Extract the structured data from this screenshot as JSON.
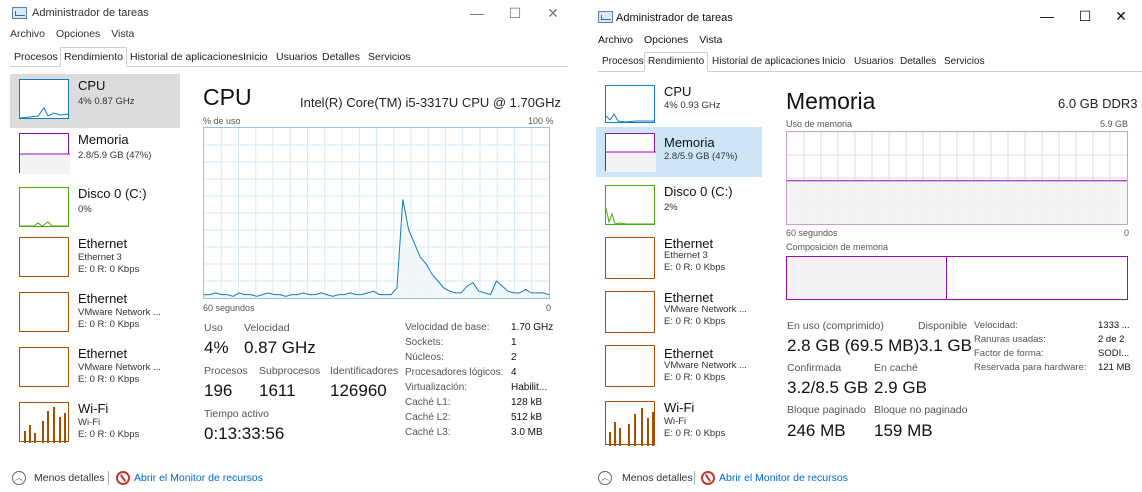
{
  "colors": {
    "cpu": "#117dbb",
    "cpu_fill": "#f1f6fa",
    "memory": "#8b12ae",
    "memory_fill": "#f4f2f4",
    "disk": "#4da60c",
    "ethernet": "#a74f01",
    "wifi": "#a74f01",
    "link": "#0066cc"
  },
  "left": {
    "title": "Administrador de tareas",
    "menu": [
      "Archivo",
      "Opciones",
      "Vista"
    ],
    "tabs": [
      "Procesos",
      "Rendimiento",
      "Historial de aplicaciones",
      "Inicio",
      "Usuarios",
      "Detalles",
      "Servicios"
    ],
    "sidebar": [
      {
        "name": "CPU",
        "line1": "4% 0.87 GHz",
        "line2": ""
      },
      {
        "name": "Memoria",
        "line1": "2.8/5.9 GB (47%)",
        "line2": ""
      },
      {
        "name": "Disco 0 (C:)",
        "line1": "0%",
        "line2": ""
      },
      {
        "name": "Ethernet",
        "line1": "Ethernet 3",
        "line2": "E: 0 R: 0 Kbps"
      },
      {
        "name": "Ethernet",
        "line1": "VMware Network ...",
        "line2": "E: 0 R: 0 Kbps"
      },
      {
        "name": "Ethernet",
        "line1": "VMware Network ...",
        "line2": "E: 0 R: 0 Kbps"
      },
      {
        "name": "Wi-Fi",
        "line1": "Wi-Fi",
        "line2": "E: 0 R: 0 Kbps"
      }
    ],
    "panel": {
      "title": "CPU",
      "spec": "Intel(R) Core(TM) i5-3317U CPU @ 1.70GHz",
      "graph_label": "% de uso",
      "graph_max": "100 %",
      "time_label": "60 segundos",
      "time_end": "0",
      "cpu_history": [
        2,
        2,
        3,
        2,
        2,
        1,
        3,
        2,
        2,
        1,
        2,
        3,
        2,
        2,
        1,
        2,
        2,
        3,
        2,
        2,
        3,
        2,
        1,
        2,
        2,
        3,
        2,
        2,
        3,
        4,
        2,
        2,
        2,
        6,
        58,
        40,
        32,
        24,
        20,
        14,
        10,
        6,
        4,
        3,
        3,
        7,
        9,
        4,
        3,
        2,
        10,
        7,
        4,
        3,
        3,
        5,
        3,
        3,
        3,
        2
      ],
      "stats": {
        "uso_label": "Uso",
        "uso_value": "4%",
        "velocidad_label": "Velocidad",
        "velocidad_value": "0.87 GHz",
        "procesos_label": "Procesos",
        "procesos_value": "196",
        "subprocesos_label": "Subprocesos",
        "subprocesos_value": "1611",
        "identificadores_label": "Identificadores",
        "identificadores_value": "126960",
        "tiempo_label": "Tiempo activo",
        "tiempo_value": "0:13:33:56"
      },
      "specs": [
        {
          "label": "Velocidad de base:",
          "value": "1.70 GHz"
        },
        {
          "label": "Sockets:",
          "value": "1"
        },
        {
          "label": "Núcleos:",
          "value": "2"
        },
        {
          "label": "Procesadores lógicos:",
          "value": "4"
        },
        {
          "label": "Virtualización:",
          "value": "Habilit..."
        },
        {
          "label": "Caché L1:",
          "value": "128 kB"
        },
        {
          "label": "Caché L2:",
          "value": "512 kB"
        },
        {
          "label": "Caché L3:",
          "value": "3.0 MB"
        }
      ]
    },
    "footer": {
      "less": "Menos detalles",
      "monitor": "Abrir el Monitor de recursos"
    }
  },
  "right": {
    "title": "Administrador de tareas",
    "menu": [
      "Archivo",
      "Opciones",
      "Vista"
    ],
    "tabs": [
      "Procesos",
      "Rendimiento",
      "Historial de aplicaciones",
      "Inicio",
      "Usuarios",
      "Detalles",
      "Servicios"
    ],
    "sidebar": [
      {
        "name": "CPU",
        "line1": "4% 0.93 GHz",
        "line2": ""
      },
      {
        "name": "Memoria",
        "line1": "2.8/5.9 GB (47%)",
        "line2": ""
      },
      {
        "name": "Disco 0 (C:)",
        "line1": "2%",
        "line2": ""
      },
      {
        "name": "Ethernet",
        "line1": "Ethernet 3",
        "line2": "E: 0 R: 0 Kbps"
      },
      {
        "name": "Ethernet",
        "line1": "VMware Network ...",
        "line2": "E: 0 R: 0 Kbps"
      },
      {
        "name": "Ethernet",
        "line1": "VMware Network ...",
        "line2": "E: 0 R: 0 Kbps"
      },
      {
        "name": "Wi-Fi",
        "line1": "Wi-Fi",
        "line2": "E: 0 R: 0 Kbps"
      }
    ],
    "panel": {
      "title": "Memoria",
      "spec": "6.0 GB DDR3",
      "graph_label": "Uso de memoria",
      "graph_max": "5.9 GB",
      "time_label": "60 segundos",
      "time_end": "0",
      "composition_label": "Composición de memoria",
      "memory_used_fraction": 0.47,
      "stats": {
        "enuso_label": "En uso (comprimido)",
        "enuso_value": "2.8 GB (69.5 MB)",
        "disponible_label": "Disponible",
        "disponible_value": "3.1 GB",
        "confirmada_label": "Confirmada",
        "confirmada_value": "3.2/8.5 GB",
        "encache_label": "En caché",
        "encache_value": "2.9 GB",
        "paginado_label": "Bloque paginado",
        "paginado_value": "246 MB",
        "nopaginado_label": "Bloque no paginado",
        "nopaginado_value": "159 MB"
      },
      "specs": [
        {
          "label": "Velocidad:",
          "value": "1333 ..."
        },
        {
          "label": "Ranuras usadas:",
          "value": "2 de 2"
        },
        {
          "label": "Factor de forma:",
          "value": "SODI..."
        },
        {
          "label": "Reservada para hardware:",
          "value": "121 MB"
        }
      ]
    },
    "footer": {
      "less": "Menos detalles",
      "monitor": "Abrir el Monitor de recursos"
    }
  }
}
